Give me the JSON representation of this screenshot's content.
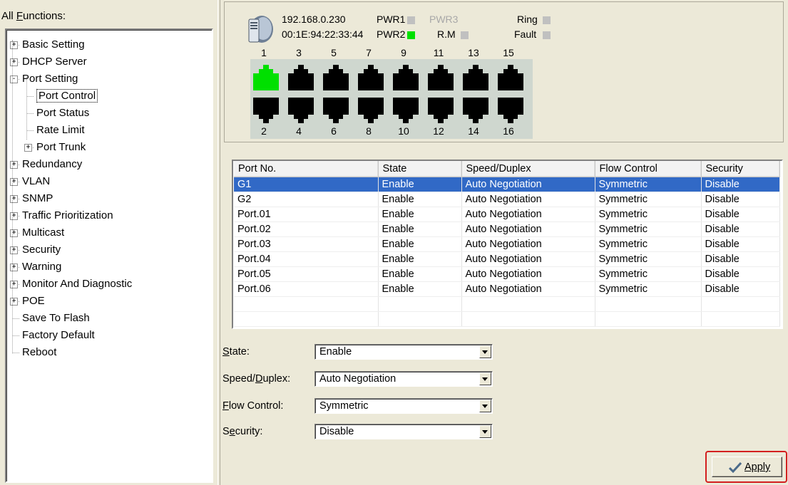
{
  "left_panel": {
    "title": "All Functions:",
    "tree": [
      {
        "label": "Basic Setting",
        "expander": "+"
      },
      {
        "label": "DHCP Server",
        "expander": "+"
      },
      {
        "label": "Port Setting",
        "expander": "−"
      },
      {
        "label": "Port Control"
      },
      {
        "label": "Port Status"
      },
      {
        "label": "Rate Limit"
      },
      {
        "label": "Port Trunk",
        "expander": "+"
      },
      {
        "label": "Redundancy",
        "expander": "+"
      },
      {
        "label": "VLAN",
        "expander": "+"
      },
      {
        "label": "SNMP",
        "expander": "+"
      },
      {
        "label": "Traffic Prioritization",
        "expander": "+"
      },
      {
        "label": "Multicast",
        "expander": "+"
      },
      {
        "label": "Security",
        "expander": "+"
      },
      {
        "label": "Warning",
        "expander": "+"
      },
      {
        "label": "Monitor And Diagnostic",
        "expander": "+"
      },
      {
        "label": "POE",
        "expander": "+"
      },
      {
        "label": "Save To Flash"
      },
      {
        "label": "Factory Default"
      },
      {
        "label": "Reboot"
      }
    ]
  },
  "device": {
    "ip": "192.168.0.230",
    "mac": "00:1E:94:22:33:44",
    "pwr1": "PWR1",
    "pwr2": "PWR2",
    "pwr3": "PWR3",
    "rm": "R.M",
    "ring": "Ring",
    "fault": "Fault",
    "led_on_color": "#00e000",
    "led_off_color": "#c0c0c0"
  },
  "ports": {
    "top_numbers": [
      "1",
      "3",
      "5",
      "7",
      "9",
      "11",
      "13",
      "15"
    ],
    "bottom_numbers": [
      "2",
      "4",
      "6",
      "8",
      "10",
      "12",
      "14",
      "16"
    ],
    "active_port": "1"
  },
  "table": {
    "headers": [
      "Port No.",
      "State",
      "Speed/Duplex",
      "Flow Control",
      "Security"
    ],
    "rows": [
      [
        "G1",
        "Enable",
        "Auto Negotiation",
        "Symmetric",
        "Disable"
      ],
      [
        "G2",
        "Enable",
        "Auto Negotiation",
        "Symmetric",
        "Disable"
      ],
      [
        "Port.01",
        "Enable",
        "Auto Negotiation",
        "Symmetric",
        "Disable"
      ],
      [
        "Port.02",
        "Enable",
        "Auto Negotiation",
        "Symmetric",
        "Disable"
      ],
      [
        "Port.03",
        "Enable",
        "Auto Negotiation",
        "Symmetric",
        "Disable"
      ],
      [
        "Port.04",
        "Enable",
        "Auto Negotiation",
        "Symmetric",
        "Disable"
      ],
      [
        "Port.05",
        "Enable",
        "Auto Negotiation",
        "Symmetric",
        "Disable"
      ],
      [
        "Port.06",
        "Enable",
        "Auto Negotiation",
        "Symmetric",
        "Disable"
      ]
    ],
    "selected_row": 0
  },
  "form": {
    "state_label": "State:",
    "state_value": "Enable",
    "speed_label": "Speed/Duplex:",
    "speed_value": "Auto Negotiation",
    "flow_label": "Flow Control:",
    "flow_value": "Symmetric",
    "security_label": "Security:",
    "security_value": "Disable"
  },
  "apply_label": "Apply"
}
